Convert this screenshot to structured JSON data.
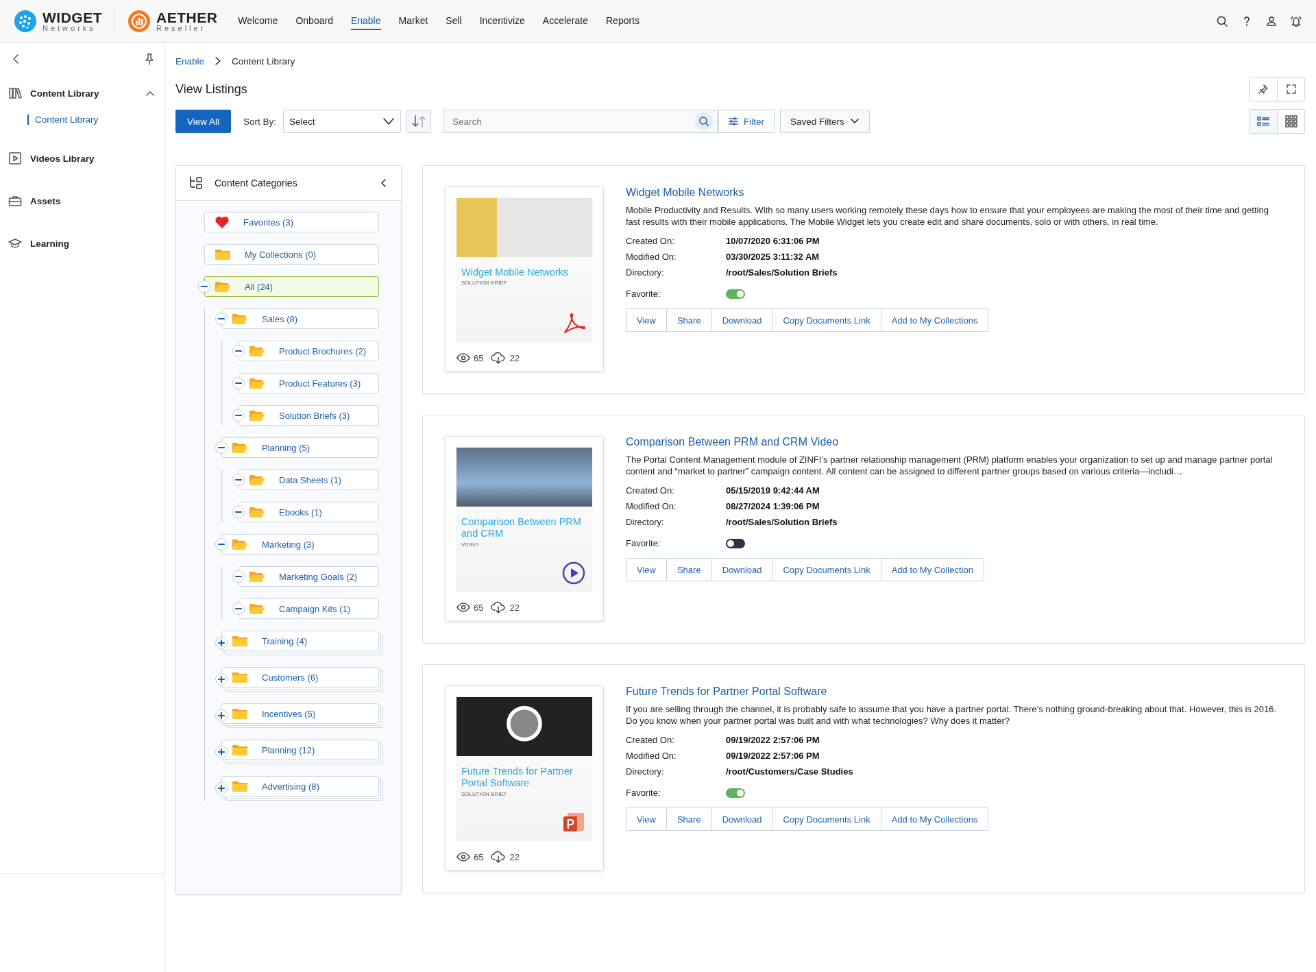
{
  "header": {
    "brand": {
      "name": "WIDGET",
      "tagline": "Networks"
    },
    "partner": {
      "name": "AETHER",
      "tagline": "Reseller"
    },
    "nav": [
      {
        "label": "Welcome",
        "selected": false
      },
      {
        "label": "Onboard",
        "selected": false
      },
      {
        "label": "Enable",
        "selected": true
      },
      {
        "label": "Market",
        "selected": false
      },
      {
        "label": "Sell",
        "selected": false
      },
      {
        "label": "Incentivize",
        "selected": false
      },
      {
        "label": "Accelerate",
        "selected": false
      },
      {
        "label": "Reports",
        "selected": false
      }
    ]
  },
  "sidebar": {
    "items": [
      {
        "label": "Content Library",
        "expanded": true,
        "children": [
          {
            "label": "Content Library",
            "selected": true
          }
        ]
      },
      {
        "label": "Videos Library"
      },
      {
        "label": "Assets"
      },
      {
        "label": "Learning"
      }
    ]
  },
  "breadcrumb": [
    "Enable",
    "Content Library"
  ],
  "page_title": "View Listings",
  "toolbar": {
    "view_all": "View All",
    "sort_label": "Sort By:",
    "sort_value": "Select",
    "search": {
      "placeholder": "Search"
    },
    "filter": "Filter",
    "saved_filters": "Saved Filters",
    "view_mode": [
      {
        "kind": "list",
        "selected": true
      },
      {
        "kind": "grid",
        "selected": false
      }
    ]
  },
  "categories": {
    "title": "Content Categories",
    "items": [
      {
        "label": "Favorites (3)",
        "kind": "favorites",
        "selected": false
      },
      {
        "label": "My Collections (0)",
        "kind": "collection",
        "selected": false
      },
      {
        "label": "All (24)",
        "kind": "folder",
        "selected": true,
        "expanded": true,
        "children": [
          {
            "label": "Sales (8)",
            "kind": "folder",
            "selected": false,
            "expanded": true,
            "children": [
              {
                "label": "Product Brochures (2)",
                "kind": "folder",
                "selected": false,
                "expanded": true
              },
              {
                "label": "Product Features (3)",
                "kind": "folder",
                "selected": false,
                "expanded": true
              },
              {
                "label": "Solution Briefs (3)",
                "kind": "folder",
                "selected": false,
                "expanded": true
              }
            ]
          },
          {
            "label": "Planning (5)",
            "kind": "folder",
            "selected": false,
            "expanded": true,
            "children": [
              {
                "label": "Data Sheets (1)",
                "kind": "folder",
                "selected": false,
                "expanded": true
              },
              {
                "label": "Ebooks (1)",
                "kind": "folder",
                "selected": false,
                "expanded": true
              }
            ]
          },
          {
            "label": "Marketing (3)",
            "kind": "folder",
            "selected": false,
            "expanded": true,
            "children": [
              {
                "label": "Marketing Goals (2)",
                "kind": "folder",
                "selected": false,
                "expanded": true
              },
              {
                "label": "Campaign Kits (1)",
                "kind": "folder",
                "selected": false,
                "expanded": true
              }
            ]
          },
          {
            "label": "Training (4)",
            "kind": "folder",
            "selected": false,
            "expanded": false
          },
          {
            "label": "Customers (6)",
            "kind": "folder",
            "selected": false,
            "expanded": false
          },
          {
            "label": "Incentives (5)",
            "kind": "folder",
            "selected": false,
            "expanded": false
          },
          {
            "label": "Planning (12)",
            "kind": "folder",
            "selected": false,
            "expanded": false
          },
          {
            "label": "Advertising (8)",
            "kind": "folder",
            "selected": false,
            "expanded": false
          }
        ]
      }
    ]
  },
  "listings": [
    {
      "title": "Widget Mobile Networks",
      "description": "Mobile Productivity and Results. With so many users working remotely these days how to ensure that your employees are making the most of their time and getting fast results with their mobile applications. The Mobile Widget lets you create edit and share documents, solo or with others, in real time.",
      "thumbnail": {
        "kind": "pdf",
        "title": "Widget Mobile Networks",
        "subtitle": "SOLUTION BRIEF"
      },
      "views": "65",
      "downloads": "22",
      "fields": [
        {
          "label": "Created On:",
          "value": "10/07/2020 6:31:06 PM"
        },
        {
          "label": "Modified On:",
          "value": "03/30/2025 3:11:32 AM"
        },
        {
          "label": "Directory:",
          "value": "/root/Sales/Solution Briefs"
        }
      ],
      "favorite_label": "Favorite:",
      "favorite": true,
      "actions": [
        "View",
        "Share",
        "Download",
        "Copy Documents Link",
        "Add to My Collections"
      ]
    },
    {
      "title": "Comparison Between PRM and CRM Video",
      "description": "The Portal Content Management module of ZINFI’s partner relationship management (PRM) platform enables your organization to set up and manage partner portal content and “market to partner” campaign content. All content can be assigned to different partner groups based on various criteria—includi…",
      "thumbnail": {
        "kind": "video",
        "title": "Comparison Between PRM and CRM",
        "subtitle": "VIDEO"
      },
      "views": "65",
      "downloads": "22",
      "fields": [
        {
          "label": "Created On:",
          "value": "05/15/2019 9:42:44 AM"
        },
        {
          "label": "Modified On:",
          "value": "08/27/2024 1:39:06 PM"
        },
        {
          "label": "Directory:",
          "value": "/root/Sales/Solution Briefs"
        }
      ],
      "favorite_label": "Favorite:",
      "favorite": false,
      "actions": [
        "View",
        "Share",
        "Download",
        "Copy Documents Link",
        "Add to My Collection"
      ]
    },
    {
      "title": "Future Trends for Partner Portal Software",
      "description": "If you are selling through the channel, it is probably safe to assume that you have a partner portal. There’s nothing ground-breaking about that. However, this is 2016. Do you know when your partner portal was built and with what technologies? Why does it matter?",
      "thumbnail": {
        "kind": "ppt",
        "title": "Future Trends for Partner Portal Software",
        "subtitle": "SOLUTION BRIEF"
      },
      "views": "65",
      "downloads": "22",
      "fields": [
        {
          "label": "Created On:",
          "value": "09/19/2022 2:57:06 PM"
        },
        {
          "label": "Modified On:",
          "value": "09/19/2022 2:57:06 PM"
        },
        {
          "label": "Directory:",
          "value": "/root/Customers/Case Studies"
        }
      ],
      "favorite_label": "Favorite:",
      "favorite": true,
      "actions": [
        "View",
        "Share",
        "Download",
        "Copy Documents Link",
        "Add to My Collections"
      ]
    }
  ]
}
